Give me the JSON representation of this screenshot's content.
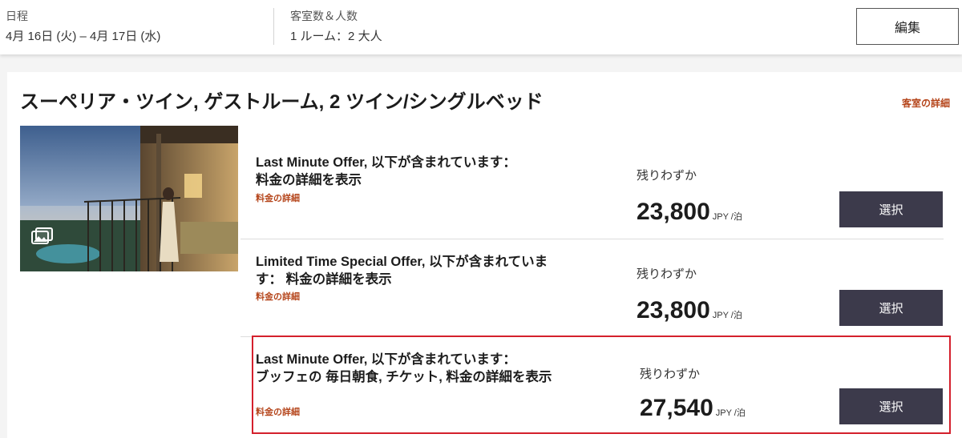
{
  "summary": {
    "dates_label": "日程",
    "dates_value": "4月 16日 (火) – 4月 17日 (水)",
    "guests_label": "客室数＆人数",
    "guests_value": "1 ルーム：2 大人",
    "edit_button": "編集"
  },
  "room": {
    "title": "スーペリア・ツイン, ゲストルーム, 2 ツイン/シングルベッド",
    "details_link": "客室の詳細",
    "photo_icon": "gallery-icon"
  },
  "rates": [
    {
      "name_bold_1": "Last Minute Offer, 以下が含まれています：",
      "name_plain": "",
      "name_bold_2": "料金の詳細を表示",
      "details_link": "料金の詳細",
      "availability": "残りわずか",
      "price": "23,800",
      "unit": "JPY /泊",
      "select_button": "選択"
    },
    {
      "name_bold_1": "Limited Time Special Offer, 以下が含まれています：",
      "name_plain": "",
      "name_bold_2": "料金の詳細を表示",
      "details_link": "料金の詳細",
      "availability": "残りわずか",
      "price": "23,800",
      "unit": "JPY /泊",
      "select_button": "選択"
    },
    {
      "name_bold_1": "Last Minute Offer, 以下が含まれています：",
      "name_plain": "",
      "name_bold_2": "ブッフェの 毎日朝食, チケット, 料金の詳細を表示",
      "details_link": "料金の詳細",
      "availability": "残りわずか",
      "price": "27,540",
      "unit": "JPY /泊",
      "select_button": "選択"
    }
  ],
  "colors": {
    "accent_link": "#b5451b",
    "button_bg": "#3c3a4b",
    "highlight_border": "#d4202c"
  }
}
